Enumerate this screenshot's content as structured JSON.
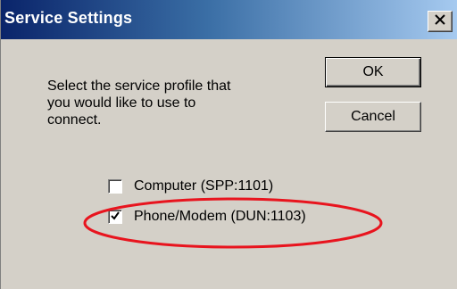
{
  "window": {
    "title": "Service Settings",
    "close_label": "X"
  },
  "content": {
    "prompt_line1": "Select the service profile that",
    "prompt_line2": "you would like to use to",
    "prompt_line3": "connect."
  },
  "buttons": {
    "ok_label": "OK",
    "cancel_label": "Cancel"
  },
  "options": [
    {
      "label": "Computer (SPP:1101)",
      "checked": false
    },
    {
      "label": "Phone/Modem (DUN:1103)",
      "checked": true
    }
  ],
  "colors": {
    "annotation": "#e8141e",
    "titlebar_start": "#0a246a",
    "titlebar_end": "#a6caf0",
    "face": "#d4d0c8"
  }
}
